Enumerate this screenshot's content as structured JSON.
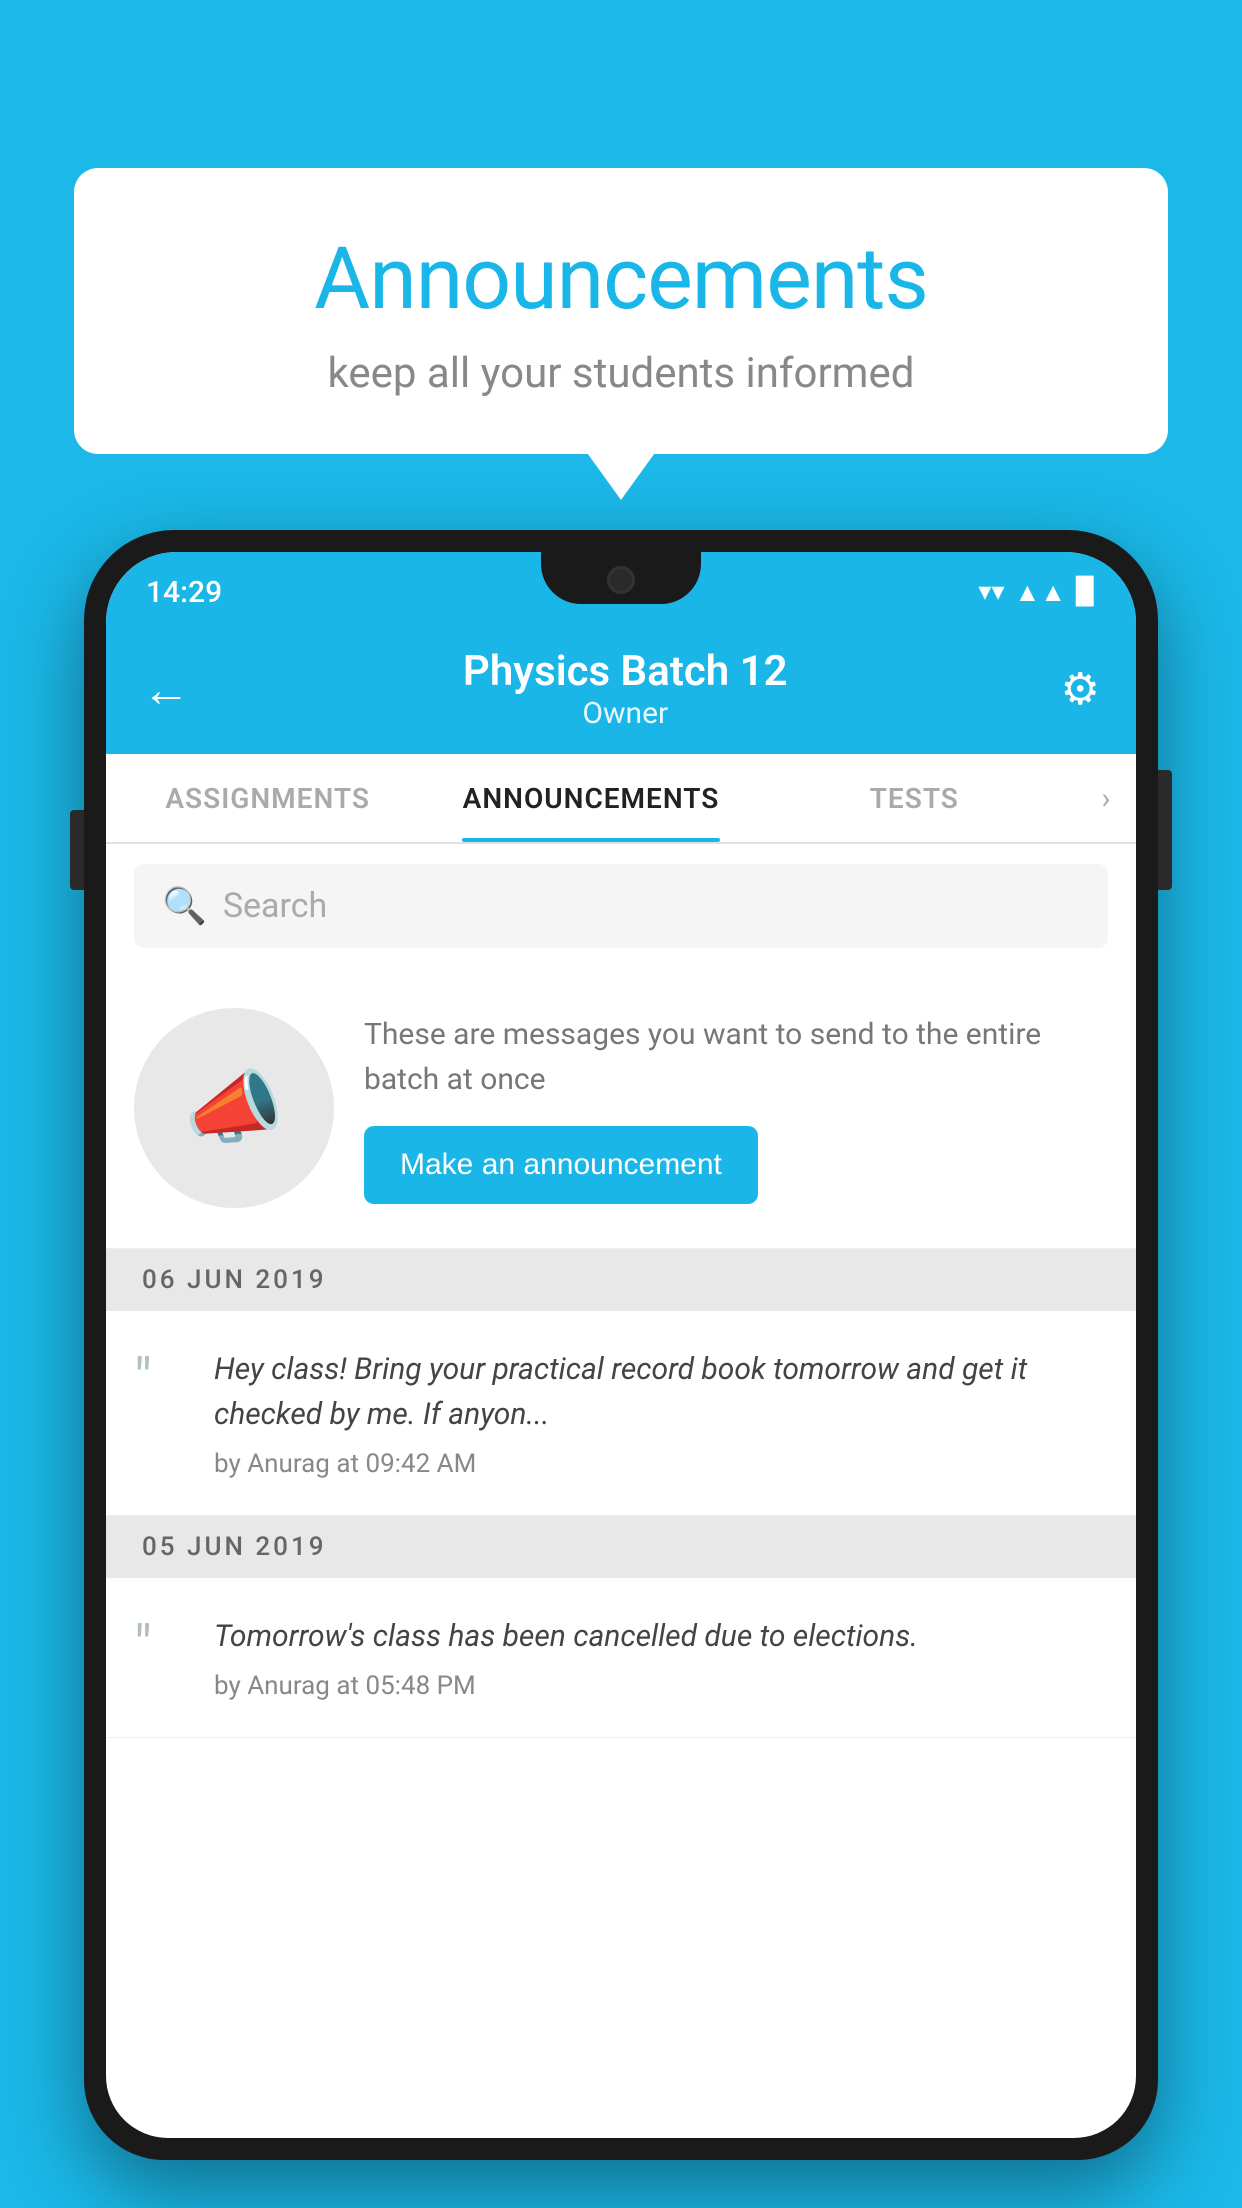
{
  "background_color": "#1bb8e8",
  "speech_bubble": {
    "title": "Announcements",
    "subtitle": "keep all your students informed"
  },
  "status_bar": {
    "time": "14:29",
    "wifi": "▼",
    "signal": "▲",
    "battery": "▉"
  },
  "header": {
    "title": "Physics Batch 12",
    "subtitle": "Owner",
    "back_label": "←",
    "settings_label": "⚙"
  },
  "tabs": [
    {
      "label": "ASSIGNMENTS",
      "active": false
    },
    {
      "label": "ANNOUNCEMENTS",
      "active": true
    },
    {
      "label": "TESTS",
      "active": false
    }
  ],
  "search": {
    "placeholder": "Search"
  },
  "promo": {
    "description": "These are messages you want to send to the entire batch at once",
    "button_label": "Make an announcement"
  },
  "announcements": [
    {
      "date": "06  JUN  2019",
      "text": "Hey class! Bring your practical record book tomorrow and get it checked by me. If anyon...",
      "meta": "by Anurag at 09:42 AM"
    },
    {
      "date": "05  JUN  2019",
      "text": "Tomorrow's class has been cancelled due to elections.",
      "meta": "by Anurag at 05:48 PM"
    }
  ]
}
